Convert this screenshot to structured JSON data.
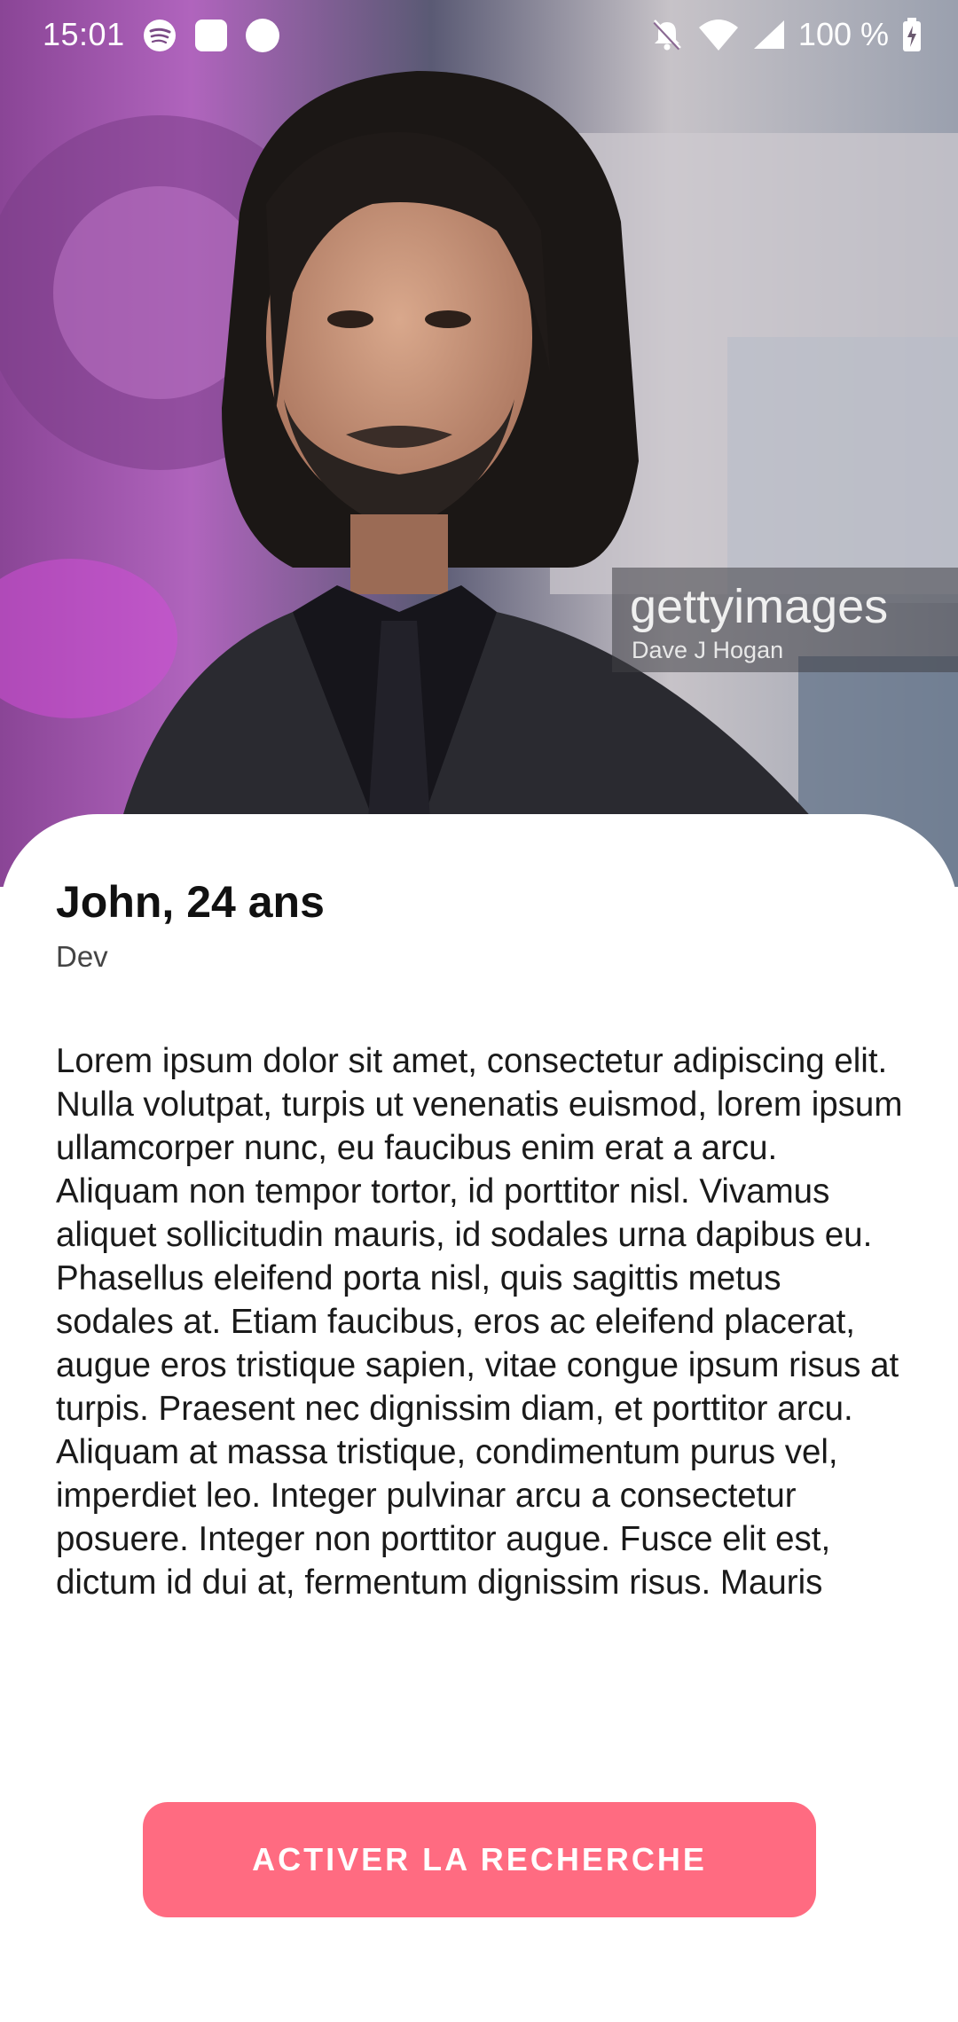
{
  "status_bar": {
    "time": "15:01",
    "left_icons": [
      "spotify-icon",
      "app-notification-icon",
      "dot-notification-icon"
    ],
    "right_icons": [
      "silent-mode-icon",
      "wifi-icon",
      "cell-signal-icon",
      "battery-charging-icon"
    ],
    "battery": "100 %"
  },
  "hero": {
    "watermark_brand": "gettyimages",
    "watermark_credit": "Dave J Hogan"
  },
  "profile": {
    "name_age": "John, 24 ans",
    "job": "Dev",
    "bio": "Lorem ipsum dolor sit amet, consectetur adipiscing elit. Nulla volutpat, turpis ut venenatis euismod, lorem ipsum ullamcorper nunc, eu faucibus enim erat a arcu. Aliquam non tempor tortor, id porttitor nisl. Vivamus aliquet sollicitudin mauris, id sodales urna dapibus eu. Phasellus eleifend porta nisl, quis sagittis metus sodales at. Etiam faucibus, eros ac eleifend placerat, augue eros tristique sapien, vitae congue ipsum risus at turpis. Praesent nec dignissim diam, et porttitor arcu. Aliquam at massa tristique, condimentum purus vel, imperdiet leo. Integer pulvinar arcu a consectetur posuere. Integer non porttitor augue. Fusce elit est, dictum id dui at, fermentum dignissim risus. Mauris"
  },
  "actions": {
    "primary_label": "ACTIVER LA RECHERCHE",
    "primary_color": "#ff6b81"
  }
}
